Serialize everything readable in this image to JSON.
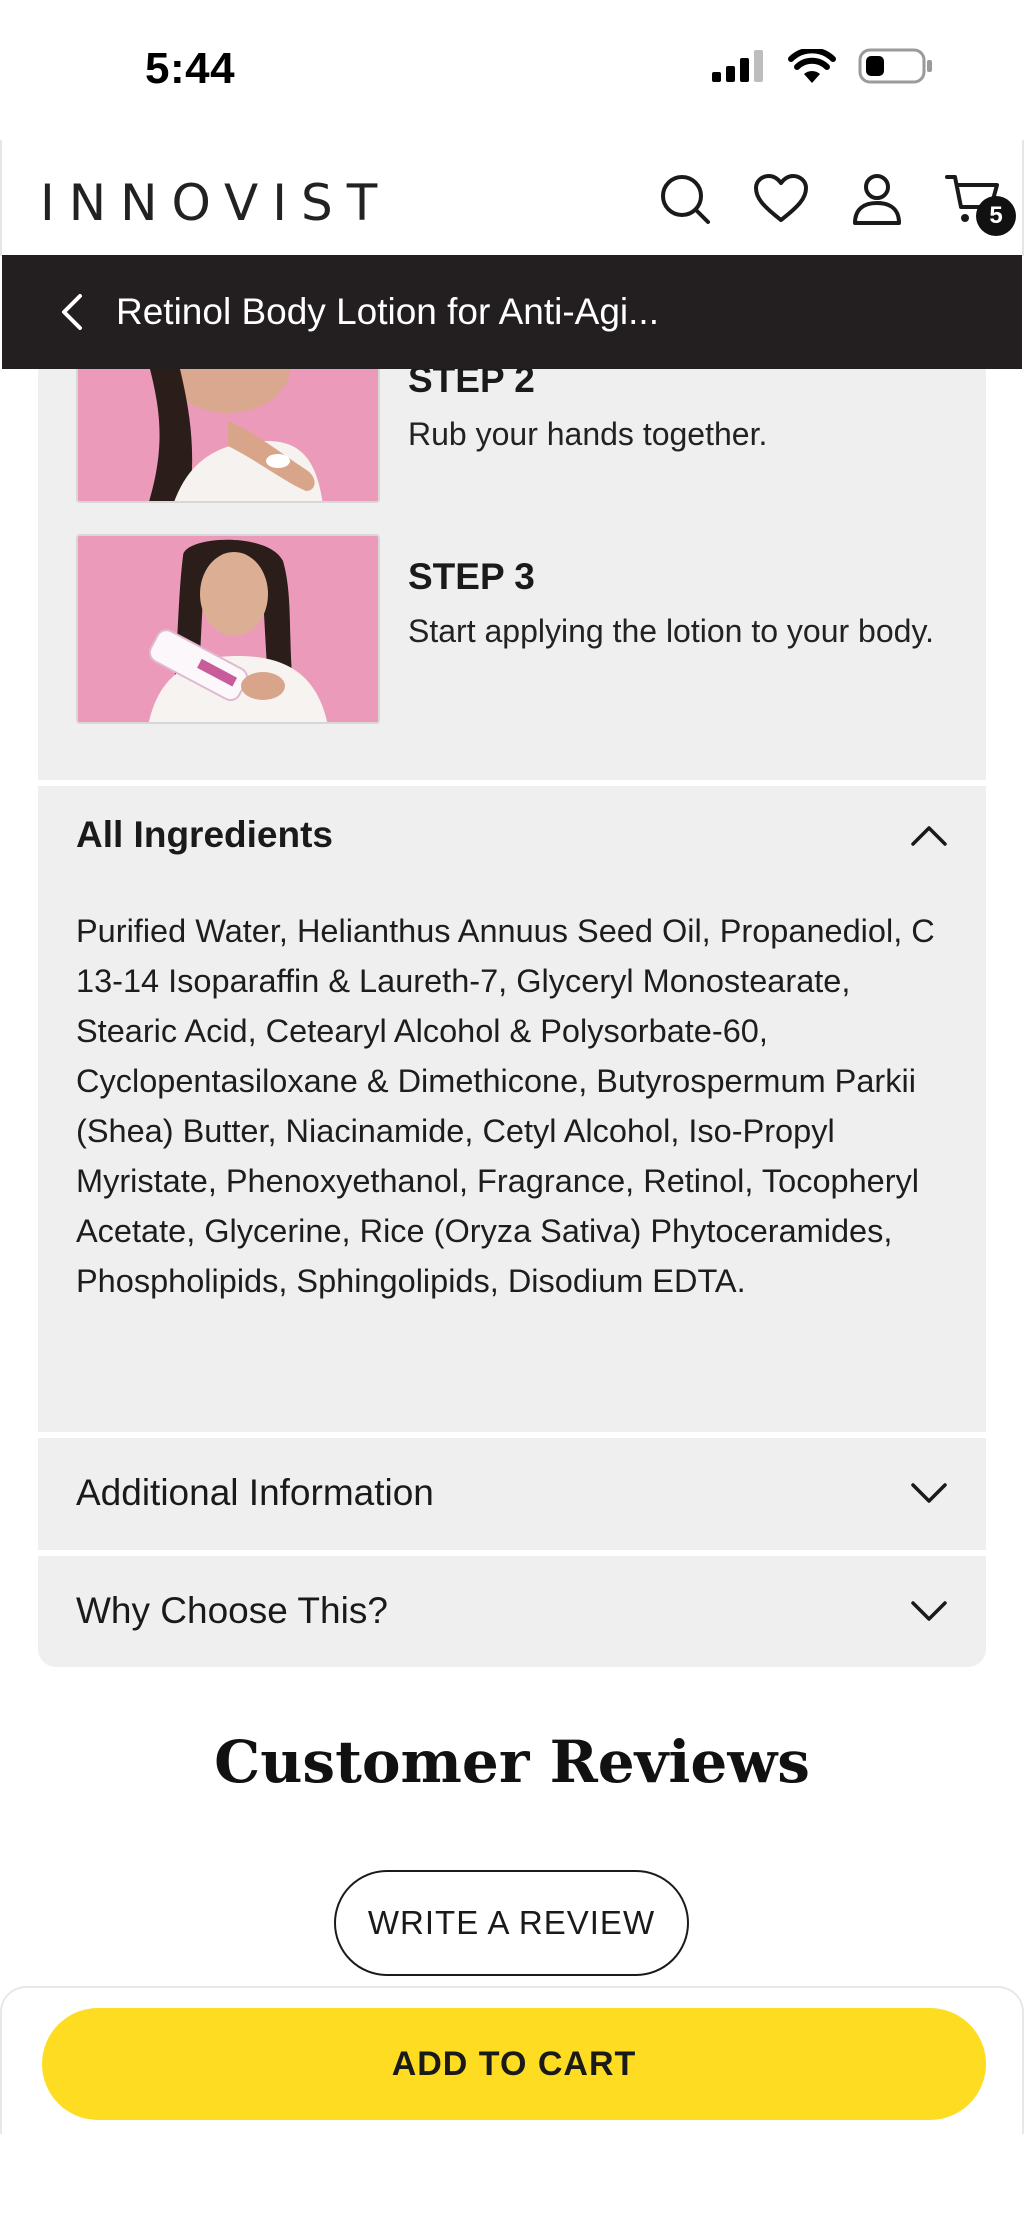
{
  "status_bar": {
    "time": "5:44"
  },
  "header": {
    "logo": "INNOVIST",
    "cart_count": "5"
  },
  "title_bar": {
    "title": "Retinol Body Lotion for Anti-Agi..."
  },
  "steps": [
    {
      "title": "STEP 2",
      "desc": "Rub your hands together."
    },
    {
      "title": "STEP 3",
      "desc": " Start applying the lotion to your body."
    }
  ],
  "ingredients": {
    "title": "All Ingredients",
    "text": "Purified Water, Helianthus Annuus Seed Oil, Propanediol, C 13-14 Isoparaffin & Laureth-7, Glyceryl Monostearate, Stearic Acid, Cetearyl Alcohol & Polysorbate-60, Cyclopentasiloxane & Dimethicone, Butyrospermum Parkii (Shea) Butter, Niacinamide, Cetyl Alcohol, Iso-Propyl Myristate, Phenoxyethanol, Fragrance, Retinol, Tocopheryl Acetate, Glycerine, Rice (Oryza Sativa) Phytoceramides, Phospholipids, Sphingolipids, Disodium EDTA."
  },
  "accordions": [
    {
      "title": "Additional Information"
    },
    {
      "title": "Why Choose This?"
    }
  ],
  "reviews": {
    "title": "Customer Reviews",
    "write_review": "WRITE A REVIEW"
  },
  "cta": {
    "add_to_cart": "ADD TO CART"
  },
  "colors": {
    "title_bar_bg": "#231f20",
    "card_bg": "#efefef",
    "cta_bg": "#fddc22"
  },
  "icons": [
    "signal-icon",
    "wifi-icon",
    "battery-icon",
    "search-icon",
    "heart-icon",
    "user-icon",
    "cart-icon",
    "back-chevron-icon",
    "chevron-up-icon",
    "chevron-down-icon"
  ]
}
